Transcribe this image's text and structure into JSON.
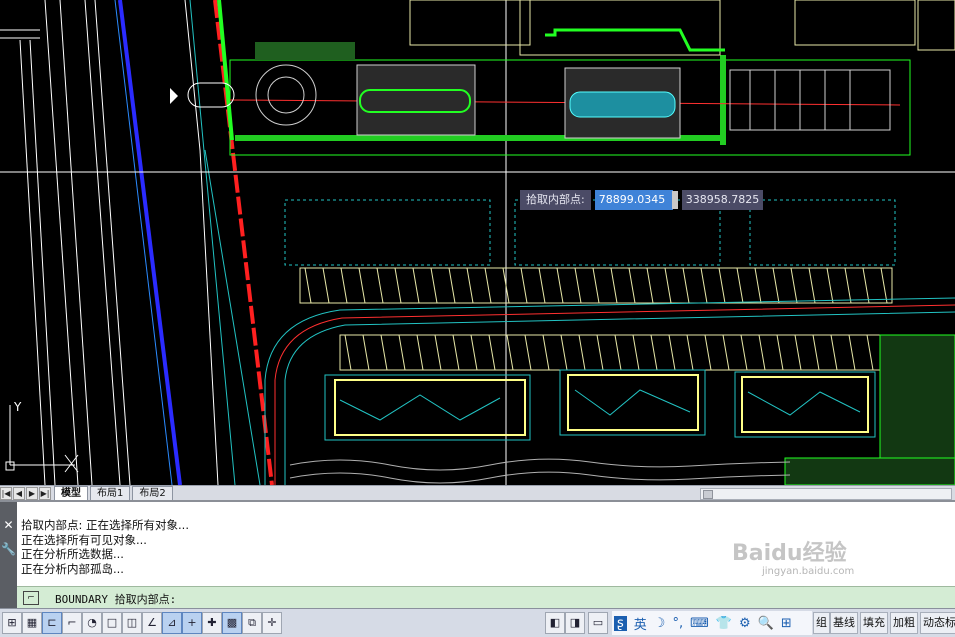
{
  "drawing": {
    "dynamic_input": {
      "label": "拾取内部点:",
      "x_value": "78899.0345",
      "y_value": "338958.7825"
    },
    "ucs_y_label": "Y"
  },
  "layout_tabs": {
    "nav": [
      "|◀",
      "◀",
      "▶",
      "▶|"
    ],
    "tabs": [
      "模型",
      "布局1",
      "布局2"
    ],
    "active": "模型"
  },
  "command_window": {
    "close_glyph": "✕",
    "settings_glyph": "🔧",
    "history": [
      "拾取内部点: 正在选择所有对象...",
      "正在选择所有可见对象...",
      "正在分析所选数据...",
      "正在分析内部孤岛..."
    ],
    "prompt": "BOUNDARY 拾取内部点:"
  },
  "status_bar": {
    "ime_items": [
      "英",
      "☽",
      "°,",
      "⌨",
      "👕",
      "⚙",
      "🔍",
      "⊞"
    ],
    "text_buttons": [
      "组",
      "基线",
      "填充",
      "加粗",
      "动态标"
    ]
  },
  "watermark": {
    "brand": "Baidu经验",
    "url": "jingyan.baidu.com"
  }
}
